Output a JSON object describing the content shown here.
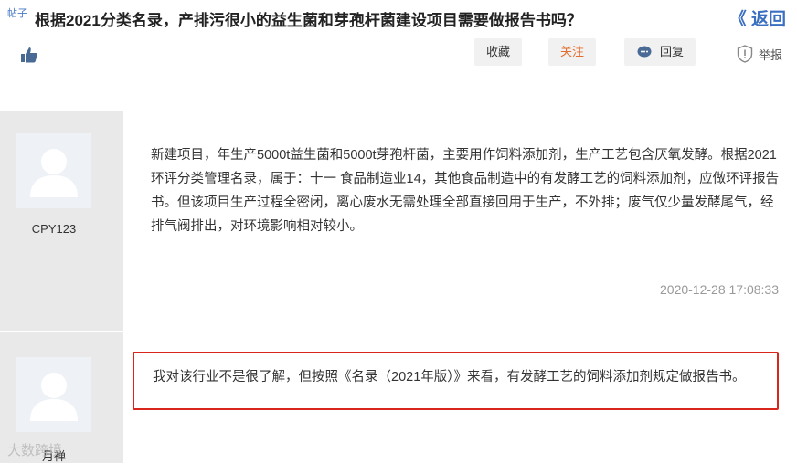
{
  "header": {
    "tag": "帖子",
    "title": "根据2021分类名录，产排污很小的益生菌和芽孢杆菌建设项目需要做报告书吗？",
    "back_label": "《 返回"
  },
  "actions": {
    "favorite": "收藏",
    "follow": "关注",
    "reply": "回复",
    "report": "举报"
  },
  "posts": [
    {
      "username": "CPY123",
      "content": "新建项目，年生产5000t益生菌和5000t芽孢杆菌，主要用作饲料添加剂，生产工艺包含厌氧发酵。根据2021环评分类管理名录，属于：十一 食品制造业14，其他食品制造中的有发酵工艺的饲料添加剂，应做环评报告书。但该项目生产过程全密闭，离心废水无需处理全部直接回用于生产，不外排；废气仅少量发酵尾气，经排气阀排出，对环境影响相对较小。",
      "time": "2020-12-28 17:08:33"
    },
    {
      "username": "月禅",
      "content": "我对该行业不是很了解，但按照《名录（2021年版）》来看，有发酵工艺的饲料添加剂规定做报告书。"
    }
  ],
  "watermark": "大数跨境",
  "colors": {
    "accent": "#3b6fc2",
    "follow": "#e26d2c",
    "highlight_border": "#d9261c"
  }
}
